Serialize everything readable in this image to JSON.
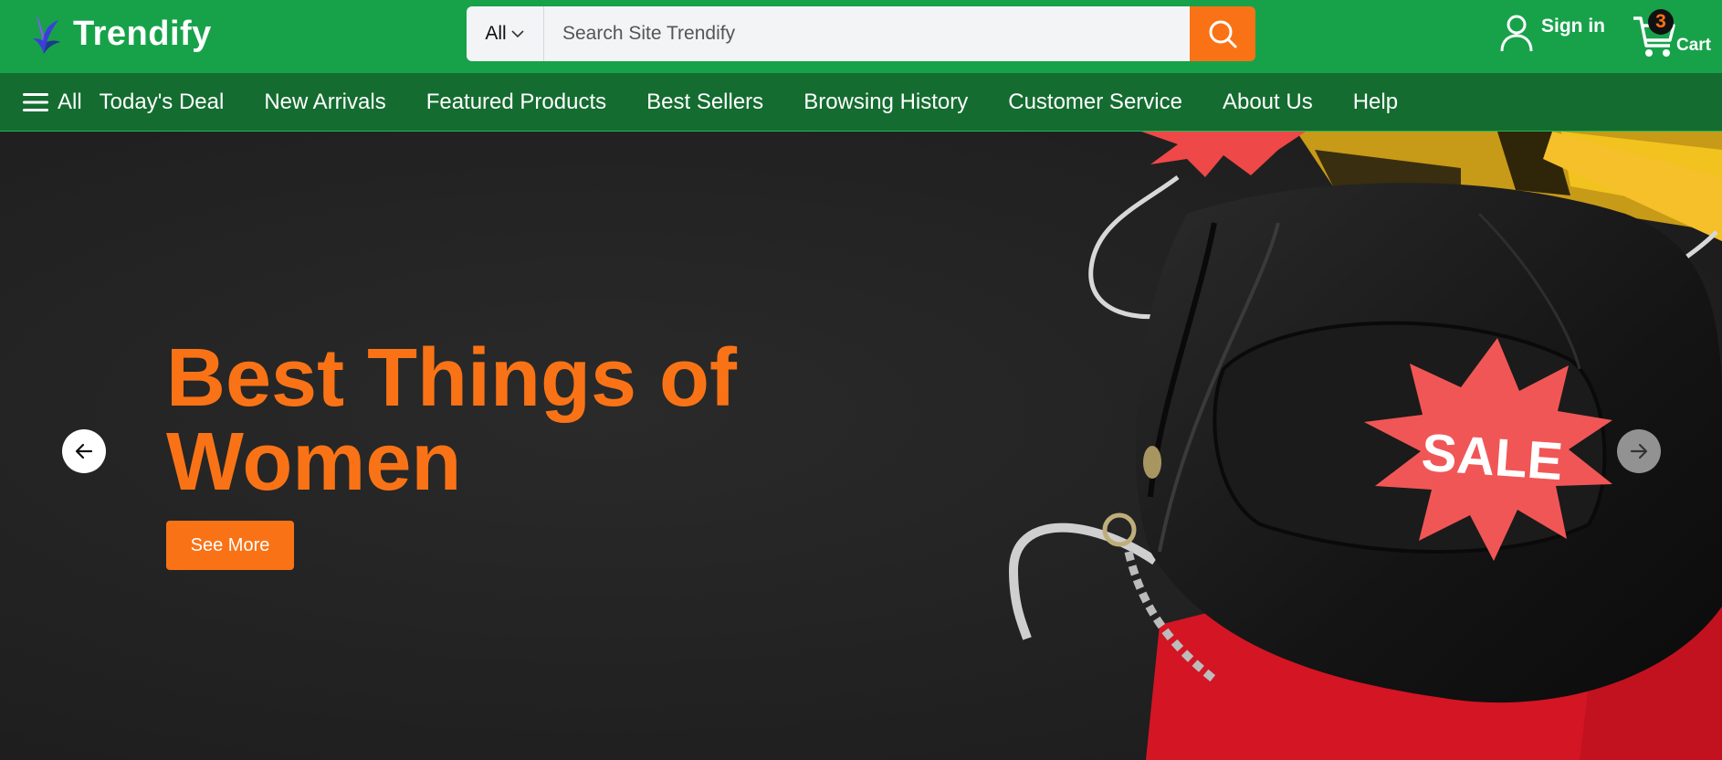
{
  "brand": {
    "name": "Trendify"
  },
  "search": {
    "category": "All",
    "placeholder": "Search Site Trendify",
    "value": ""
  },
  "account": {
    "signin_label": "Sign in"
  },
  "cart": {
    "count": "3",
    "label": "Cart"
  },
  "nav": {
    "all_label": "All",
    "items": [
      {
        "label": "Today's Deal"
      },
      {
        "label": "New Arrivals"
      },
      {
        "label": "Featured Products"
      },
      {
        "label": "Best Sellers"
      },
      {
        "label": "Browsing History"
      },
      {
        "label": "Customer Service"
      },
      {
        "label": "About Us"
      },
      {
        "label": "Help"
      }
    ]
  },
  "hero": {
    "title": "Best Things of Women",
    "cta_label": "See More",
    "badge_text": "SALE"
  },
  "icons": {
    "logo": "bird-logo-icon",
    "search": "search-icon",
    "user": "user-icon",
    "cart": "cart-icon",
    "menu": "hamburger-menu-icon",
    "prev": "arrow-left-icon",
    "next": "arrow-right-icon"
  },
  "colors": {
    "header_green": "#17a24a",
    "nav_green": "#146c30",
    "accent_orange": "#f97316",
    "hero_background": "#222222"
  }
}
